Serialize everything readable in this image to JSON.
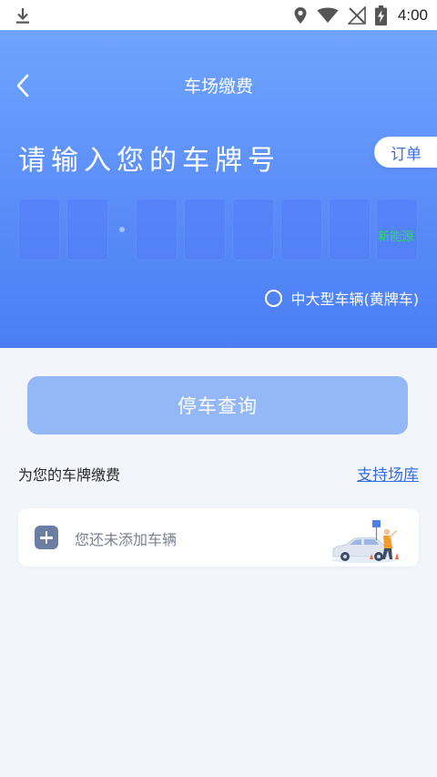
{
  "status_bar": {
    "time": "4:00"
  },
  "header": {
    "title": "车场缴费",
    "order_label": "订单"
  },
  "plate": {
    "prompt": "请输入您的车牌号",
    "new_energy_label": "新能源",
    "large_vehicle_label": "中大型车辆(黄牌车)"
  },
  "actions": {
    "query_label": "停车查询"
  },
  "vehicles": {
    "section_label": "为您的车牌缴费",
    "support_link": "支持场库",
    "empty_text": "您还未添加车辆"
  },
  "colors": {
    "accent": "#3a6de0",
    "hero_top": "#6fa4ff",
    "hero_bottom": "#4b7ef4",
    "query_button": "#93b7f7",
    "new_energy": "#2ed86a"
  },
  "icons": [
    "download-icon",
    "location-icon",
    "wifi-icon",
    "no-signal-icon",
    "battery-icon",
    "back-icon",
    "add-icon",
    "car-illustration"
  ]
}
